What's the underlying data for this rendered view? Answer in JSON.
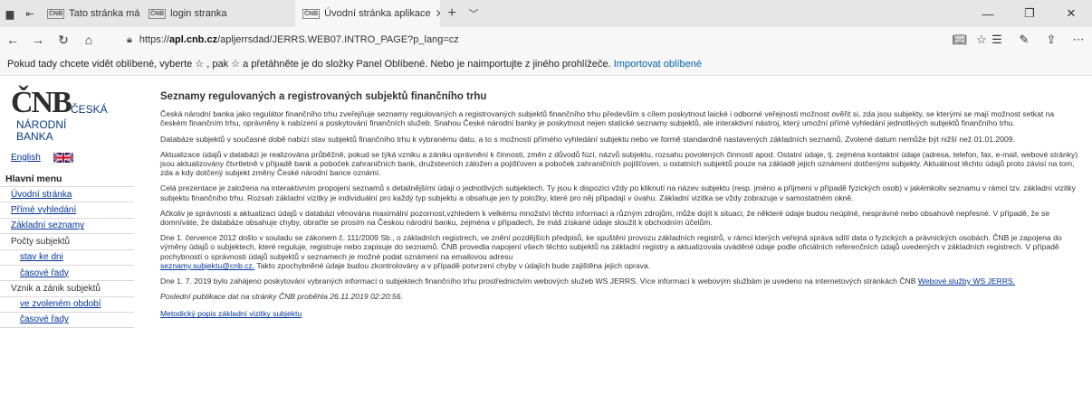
{
  "browser": {
    "tabs": [
      {
        "label": "Tato stránka má problémy s",
        "favicon": "ČNB",
        "active": false
      },
      {
        "label": "login stranka",
        "favicon": "ČNB",
        "active": false
      },
      {
        "label": "Úvodní stránka aplikace",
        "favicon": "ČNB",
        "active": true
      }
    ],
    "url_prefix": "https://",
    "url_domain": "apl.cnb.cz",
    "url_path": "/apljerrsdad/JERRS.WEB07.INTRO_PAGE?p_lang=cz",
    "favorites_prompt": "Pokud tady chcete vidět oblíbené, vyberte ☆ , pak ☆ a přetáhněte je do složky Panel Oblíbené. Nebo je naimportujte z jiného prohlížeče.",
    "favorites_import_link": "Importovat oblíbené"
  },
  "logo": {
    "mark": "ČNB",
    "line1": "ČESKÁ",
    "line2": "NÁRODNÍ",
    "line3": "BANKA"
  },
  "sidebar": {
    "english_link": "English",
    "menu_heading": "Hlavní menu",
    "items": [
      {
        "label": "Úvodní stránka",
        "link": true,
        "sub": false
      },
      {
        "label": "Přímé vyhledání",
        "link": true,
        "sub": false
      },
      {
        "label": "Základní seznamy",
        "link": true,
        "sub": false
      },
      {
        "label": "Počty subjektů",
        "link": false,
        "sub": false
      },
      {
        "label": "stav ke dni",
        "link": true,
        "sub": true
      },
      {
        "label": "časové řady",
        "link": true,
        "sub": true
      },
      {
        "label": "Vznik a zánik subjektů",
        "link": false,
        "sub": false
      },
      {
        "label": "ve zvoleném období",
        "link": true,
        "sub": true
      },
      {
        "label": "časové řady",
        "link": true,
        "sub": true
      }
    ]
  },
  "main": {
    "title": "Seznamy regulovaných a registrovaných subjektů finančního trhu",
    "paragraphs": [
      "Česká národní banka jako regulátor finančního trhu zveřejňuje seznamy regulovaných a registrovaných subjektů finančního trhu především s cílem poskytnout laické i odborné veřejnosti možnost ověřit si, zda jsou subjekty, se kterými se mají možnost setkat na českém finančním trhu, oprávněny k nabízení a poskytování finančních služeb. Snahou České národní banky je poskytnout nejen statické seznamy subjektů, ale interaktivní nástroj, který umožní přímé vyhledání jednotlivých subjektů finančního trhu.",
      "Databáze subjektů v současné době nabízí stav subjektů finančního trhu k vybranému datu, a to s možností přímého vyhledání subjektu nebo ve formě standardně nastavených základních seznamů. Zvolené datum nemůže být nižší než 01.01.2009.",
      "Aktualizace údajů v databázi je realizována průběžně, pokud se týká vzniku a zániku oprávnění k činnosti, změn z důvodů fúzí, názvů subjektu, rozsahu povolených činností apod. Ostatní údaje, tj. zejména kontaktní údaje (adresa, telefon, fax, e-mail, webové stránky) jsou aktualizovány čtvrtletně v případě bank a poboček zahraničních bank, družstevních záložen a pojišťoven a poboček zahraničních pojišťoven, u ostatních subjektů pouze na základě jejich oznámení dotčenými subjekty. Aktuálnost těchto údajů proto závisí na tom, zda a kdy dotčený subjekt změny České národní bance oznámí.",
      "Celá prezentace je založena na interaktivním propojení seznamů s detailnějšími údaji o jednotlivých subjektech. Ty jsou k dispozici vždy po kliknutí na název subjektu (resp. jméno a příjmení v případě fyzických osob) v jakémkoliv seznamu v rámci tzv. základní vizitky subjektu finančního trhu. Rozsah základní vizitky je individuální pro každý typ subjektu a obsahuje jen ty položky, které pro něj připadají v úvahu. Základní vizitka se vždy zobrazuje v samostatném okně.",
      "Ačkoliv je správnosti a aktualizaci údajů v databázi věnována maximální pozornost,vzhledem k velkému množství těchto informací a různým zdrojům, může dojít k situaci, že některé údaje budou neúplné, nesprávné nebo obsahově nepřesné. V případě, že se domníváte, že databáze obsahuje chyby, obraťte se prosím na Českou národní banku, zejména v případech, že máš získané údaje sloužit k obchodním účelům."
    ],
    "para_law_text": "Dne 1. července 2012 došlo v souladu se zákonem č. 111/2009 Sb., o základních registrech, ve znění pozdějších předpisů, ke spuštění provozu základních registrů, v rámci kterých veřejná správa sdílí data o fyzických a právnických osobách. ČNB je zapojena do výměny údajů o subjektech, které reguluje, registruje nebo zapisuje do seznamů. ČNB provedla napojení všech těchto subjektů na základní registry a aktualizovala uváděné údaje podle oficiálních referenčních údajů uvedených v základních registrech. V případě pochybností o správnosti údajů subjektů v seznamech je možné podat oznámení na emailovou adresu",
    "para_law_email": "seznamy.subjektu@cnb.cz.",
    "para_law_tail": " Takto zpochybněné údaje budou zkontrolovány a v případě potvrzení chyby v údajích bude zajištěna jejich oprava.",
    "para_ws_text": "Dne 1. 7. 2019 bylo zahájeno poskytování vybraných informací o subjektech finančního trhu prostřednictvím webových služeb WS JERRS. Více informací k webovým službám je uvedeno na internetových stránkách ČNB",
    "para_ws_link": "Webové služby WS JERRS.",
    "last_publication": "Poslední publikace dat na stránky ČNB proběhla 26.11.2019 02:20:56.",
    "bottom_link": "Metodický popis základní vizitky subjektu"
  }
}
